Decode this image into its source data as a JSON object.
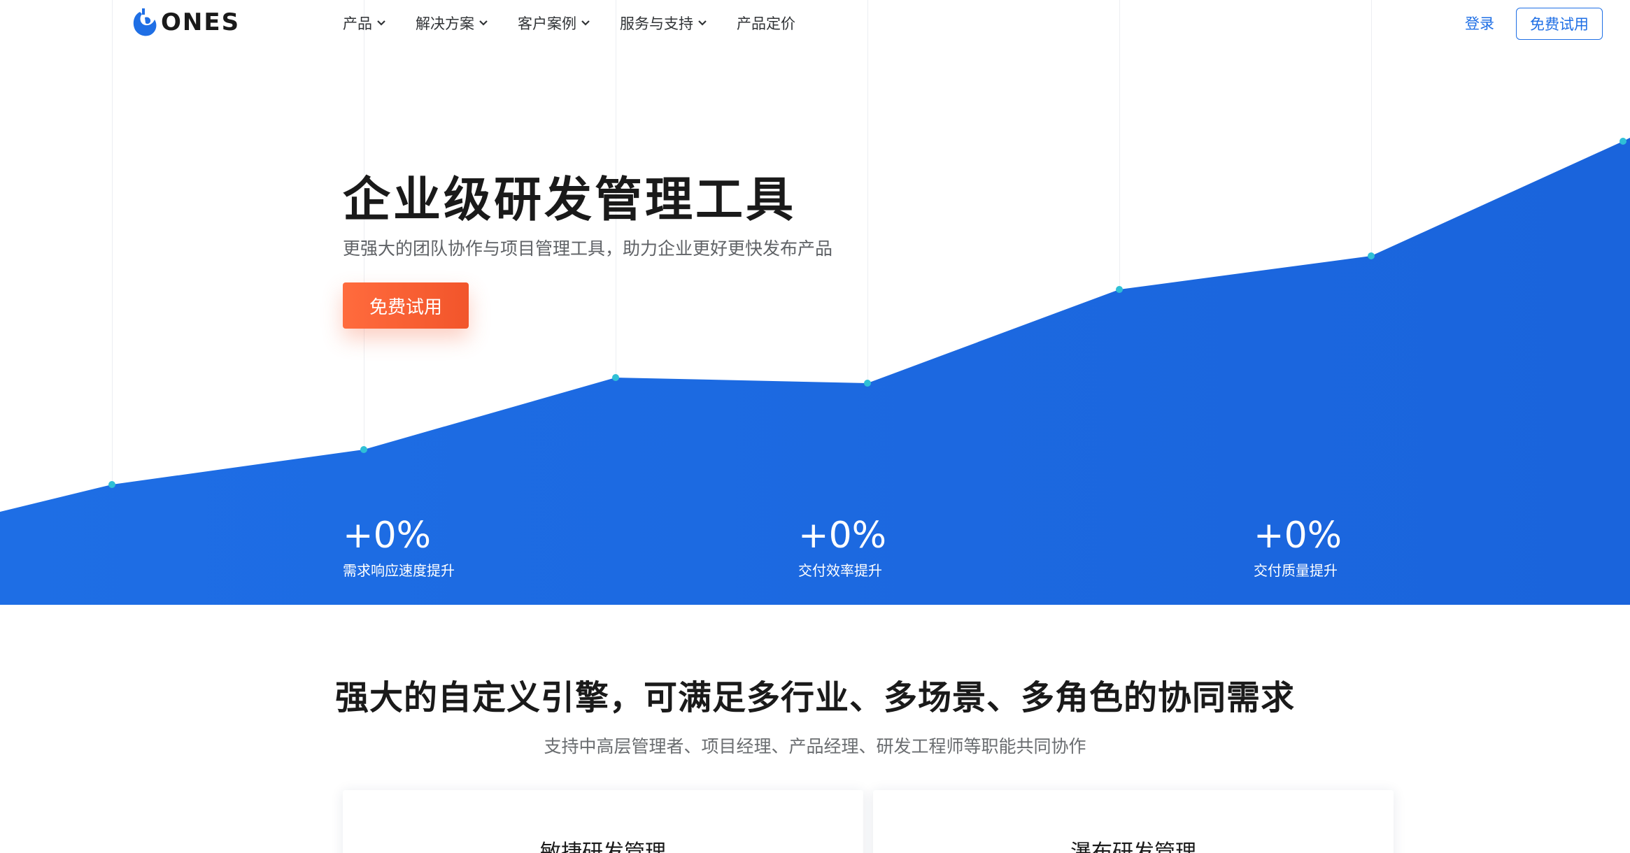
{
  "nav": {
    "logo_text": "ONES",
    "menu": [
      {
        "label": "产品",
        "has_dropdown": true
      },
      {
        "label": "解决方案",
        "has_dropdown": true
      },
      {
        "label": "客户案例",
        "has_dropdown": true
      },
      {
        "label": "服务与支持",
        "has_dropdown": true
      },
      {
        "label": "产品定价",
        "has_dropdown": false
      }
    ],
    "login_label": "登录",
    "trial_label": "免费试用"
  },
  "hero": {
    "title": "企业级研发管理工具",
    "subtitle": "更强大的团队协作与项目管理工具，助力企业更好更快发布产品",
    "cta_label": "免费试用",
    "stats": [
      {
        "value": "+0%",
        "label": "需求响应速度提升"
      },
      {
        "value": "+0%",
        "label": "交付效率提升"
      },
      {
        "value": "+0%",
        "label": "交付质量提升"
      }
    ]
  },
  "section": {
    "title": "强大的自定义引擎，可满足多行业、多场景、多角色的协同需求",
    "subtitle": "支持中高层管理者、项目经理、产品经理、研发工程师等职能共同协作",
    "cards": [
      {
        "title": "敏捷研发管理"
      },
      {
        "title": "瀑布研发管理"
      }
    ]
  },
  "colors": {
    "brand_blue": "#1f6fe5",
    "hero_fill": "#1c6ae0",
    "cta_orange": "#f2552b",
    "chart_dot": "#2fc0d6"
  },
  "icons": [
    "ones-logo-icon",
    "chevron-down-icon"
  ]
}
